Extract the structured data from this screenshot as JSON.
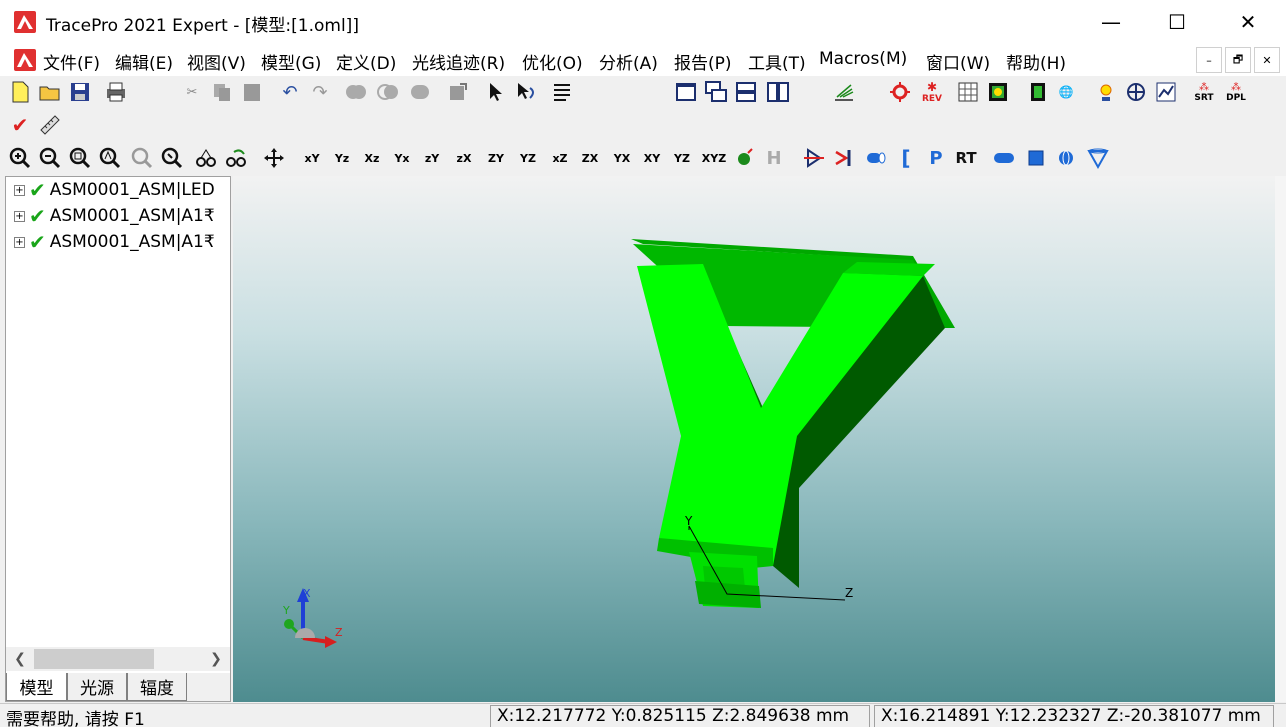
{
  "window": {
    "title": "TracePro 2021 Expert - [模型:[1.oml]]",
    "minimize_glyph": "—",
    "maximize_glyph": "☐",
    "close_glyph": "✕"
  },
  "menu": [
    {
      "label": "文件(F)"
    },
    {
      "label": "编辑(E)"
    },
    {
      "label": "视图(V)"
    },
    {
      "label": "模型(G)"
    },
    {
      "label": "定义(D)"
    },
    {
      "label": "光线追迹(R)"
    },
    {
      "label": "优化(O)"
    },
    {
      "label": "分析(A)"
    },
    {
      "label": "报告(P)"
    },
    {
      "label": "工具(T)"
    },
    {
      "label": "Macros(M)"
    },
    {
      "label": "窗口(W)"
    },
    {
      "label": "帮助(H)"
    }
  ],
  "mdi_controls": {
    "min": "–",
    "restore": "🗗",
    "close": "✕"
  },
  "toolbar": {
    "rev_label": "REV",
    "srt_label": "SRT",
    "dpl_label": "DPL",
    "p_label": "P",
    "rt_label": "RT",
    "h_label": "H",
    "axis_buttons": [
      "xY",
      "Yz",
      "Xz",
      "Yx",
      "zY",
      "zX",
      "ZY",
      "YZ",
      "xZ",
      "ZX",
      "YX",
      "XY",
      "YZ",
      "XYZ"
    ]
  },
  "tree": {
    "items": [
      {
        "label": "ASM0001_ASM|LED"
      },
      {
        "label": "ASM0001_ASM|A1₹"
      },
      {
        "label": "ASM0001_ASM|A1₹"
      }
    ],
    "expander": "+"
  },
  "panel_tabs": [
    {
      "label": "模型"
    },
    {
      "label": "光源"
    },
    {
      "label": "辐度"
    }
  ],
  "viewport": {
    "triad_labels": {
      "x": "X",
      "y": "Y",
      "z": "Z"
    },
    "local_axis_labels": {
      "y": "Y",
      "z": "Z"
    },
    "model_color": "#00ff00"
  },
  "status": {
    "help": "需要帮助, 请按 F1",
    "coord1": "X:12.217772 Y:0.825115 Z:2.849638 mm",
    "coord2": "X:16.214891 Y:12.232327 Z:-20.381077 mm"
  }
}
